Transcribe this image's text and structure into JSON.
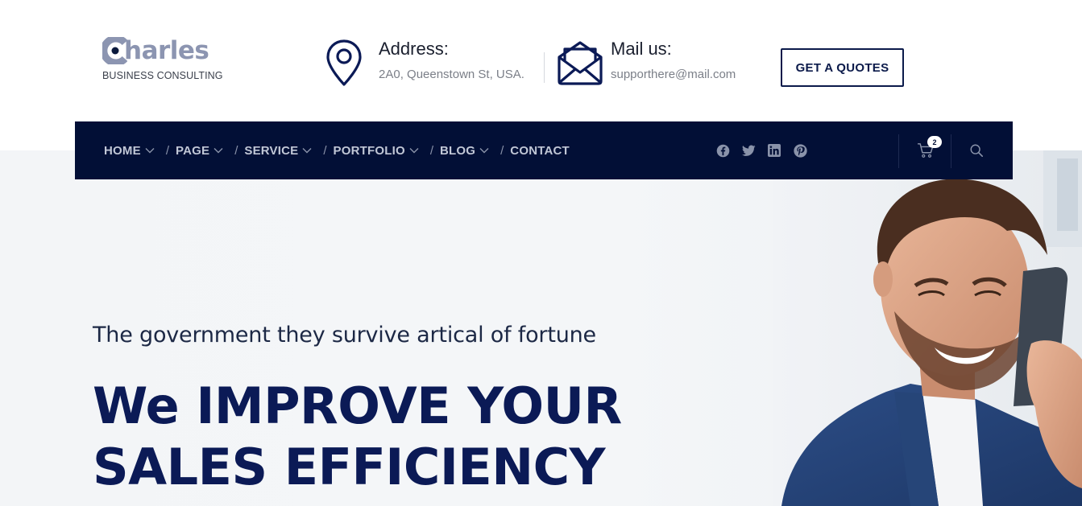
{
  "brand": {
    "name": "harles",
    "subtitle": "BUSINESS CONSULTING"
  },
  "address": {
    "title": "Address:",
    "value": "2A0, Queenstown St, USA."
  },
  "mail": {
    "title": "Mail us:",
    "value": "supporthere@mail.com"
  },
  "quote_button": "GET A QUOTES",
  "nav": {
    "items": [
      {
        "label": "HOME"
      },
      {
        "label": "PAGE"
      },
      {
        "label": "SERVICE"
      },
      {
        "label": "PORTFOLIO"
      },
      {
        "label": "BLOG"
      },
      {
        "label": "CONTACT"
      }
    ],
    "separator": "/",
    "socials": [
      "facebook-icon",
      "twitter-icon",
      "linkedin-icon",
      "pinterest-icon"
    ],
    "cart_count": "2"
  },
  "hero": {
    "subtitle": "The government they survive artical of fortune",
    "title_line1": "We IMPROVE YOUR",
    "title_line2": "SALES EFFICIENCY"
  },
  "colors": {
    "navy": "#020f36",
    "heading": "#0b1a56",
    "logo_gray": "#8c95b1",
    "nav_text": "#c1c7d6"
  }
}
